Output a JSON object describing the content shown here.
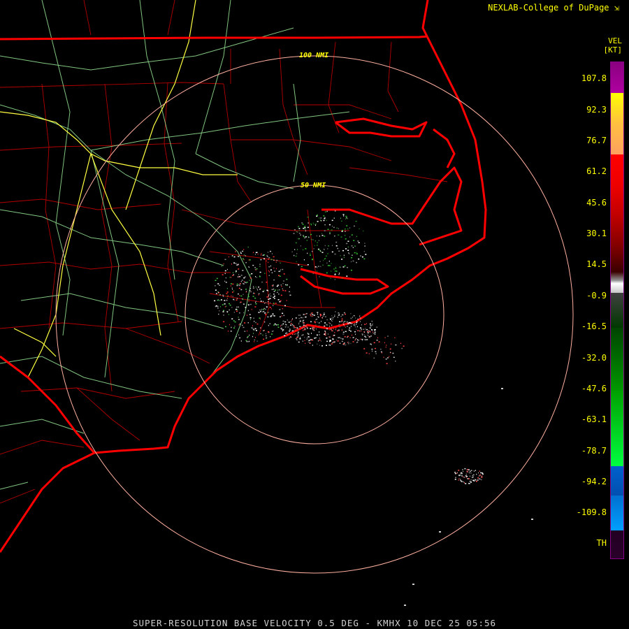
{
  "credit": {
    "text": "NEXLAB-College of DuPage",
    "icon": "cursor-arrow-icon"
  },
  "legend": {
    "product_code": "VEL",
    "unit": "[KT]",
    "labels": [
      "107.8",
      "92.3",
      "76.7",
      "61.2",
      "45.6",
      "30.1",
      "14.5",
      "-0.9",
      "-16.5",
      "-32.0",
      "-47.6",
      "-63.1",
      "-78.7",
      "-94.2",
      "-109.8",
      "TH"
    ],
    "colors": {
      "purple": "#8a0080",
      "yellow": "#ffff00",
      "orange": "#ffa060",
      "red": "#ff0000",
      "dark_red": "#3a0000",
      "gray": "#c8c8c8",
      "green": "#00cc00",
      "blue": "#0060cc",
      "cyan": "#00a0ff"
    }
  },
  "range_rings": [
    {
      "label": "50 NMI"
    },
    {
      "label": "100 NMI"
    }
  ],
  "caption": "SUPER-RESOLUTION BASE VELOCITY 0.5 DEG - KMHX 10 DEC 25 05:56",
  "map_colors": {
    "background": "#000000",
    "state_border": "#ff0000",
    "county_lines": "#c80000",
    "roads_green": "#98e898",
    "roads_yellow": "#ffff40",
    "rings": "#ffb0a0",
    "ring_label": "#ffff00"
  }
}
